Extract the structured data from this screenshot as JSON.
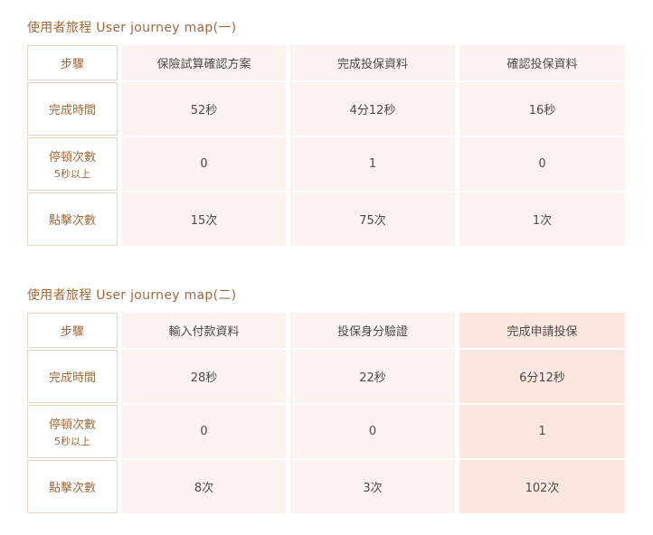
{
  "tables": [
    {
      "title": "使用者旅程 User journey map(一)",
      "header_label": "步驟",
      "columns": [
        "保險試算確認方案",
        "完成投保資料",
        "確認投保資料"
      ],
      "rows": [
        {
          "label": "完成時間",
          "sublabel": "",
          "values": [
            "52秒",
            "4分12秒",
            "16秒"
          ]
        },
        {
          "label": "停頓次數",
          "sublabel": "5秒以上",
          "values": [
            "0",
            "1",
            "0"
          ]
        },
        {
          "label": "點擊次數",
          "sublabel": "",
          "values": [
            "15次",
            "75次",
            "1次"
          ]
        }
      ],
      "highlight_column": null,
      "highlight_color": null
    },
    {
      "title": "使用者旅程 User journey map(二)",
      "header_label": "步驟",
      "columns": [
        "輸入付款資料",
        "投保身分驗證",
        "完成申請投保"
      ],
      "rows": [
        {
          "label": "完成時間",
          "sublabel": "",
          "values": [
            "28秒",
            "22秒",
            "6分12秒"
          ]
        },
        {
          "label": "停頓次數",
          "sublabel": "5秒以上",
          "values": [
            "0",
            "0",
            "1"
          ]
        },
        {
          "label": "點擊次數",
          "sublabel": "",
          "values": [
            "8次",
            "3次",
            "102次"
          ]
        }
      ],
      "highlight_column": 2,
      "highlight_color": "#fce6dd"
    }
  ],
  "colors": {
    "accent": "#a1683a",
    "label_border": "#ead2c0",
    "cell_bg": "#fdf3ee",
    "text": "#4a4a4a"
  }
}
